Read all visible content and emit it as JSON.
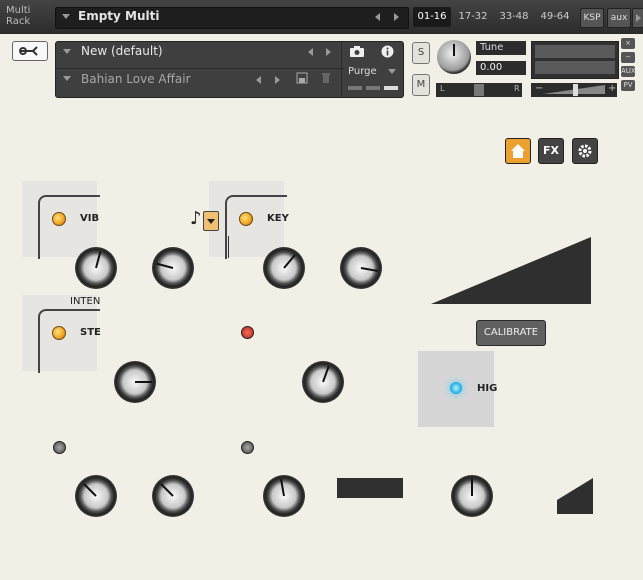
{
  "rack": {
    "title": "Multi Rack",
    "multi_name": "Empty Multi",
    "ranges": [
      "01-16",
      "17-32",
      "33-48",
      "49-64"
    ],
    "ksp": "KSP",
    "aux": "aux"
  },
  "instrument": {
    "name": "New (default)",
    "snapshot": "Bahian Love Affair",
    "purge": "Purge",
    "solo": "S",
    "mute": "M",
    "tune_label": "Tune",
    "tune_value": "0.00",
    "pan_left": "L",
    "pan_right": "R",
    "vol_minus": "−",
    "vol_plus": "+",
    "side_close": "×",
    "side_min": "−",
    "side_aux": "AUX",
    "side_pv": "PV"
  },
  "panel": {
    "fx_label": "FX",
    "vibe_label": "VIB",
    "key_label": "KEY",
    "intensity_label": "INTEN",
    "stereo_label": "STE",
    "high_label": "HIG",
    "calibrate": "CALIBRATE",
    "note_glyph": "♪"
  },
  "icons": [
    "wrench-icon",
    "camera-icon",
    "info-icon",
    "save-icon",
    "trash-icon",
    "home-icon",
    "fx-icon",
    "gear-icon"
  ],
  "colors": {
    "panel_bg": "#f2efe6",
    "led_amber": "#f0a320",
    "led_blue": "#2ab4ea",
    "home_accent": "#eba030"
  }
}
